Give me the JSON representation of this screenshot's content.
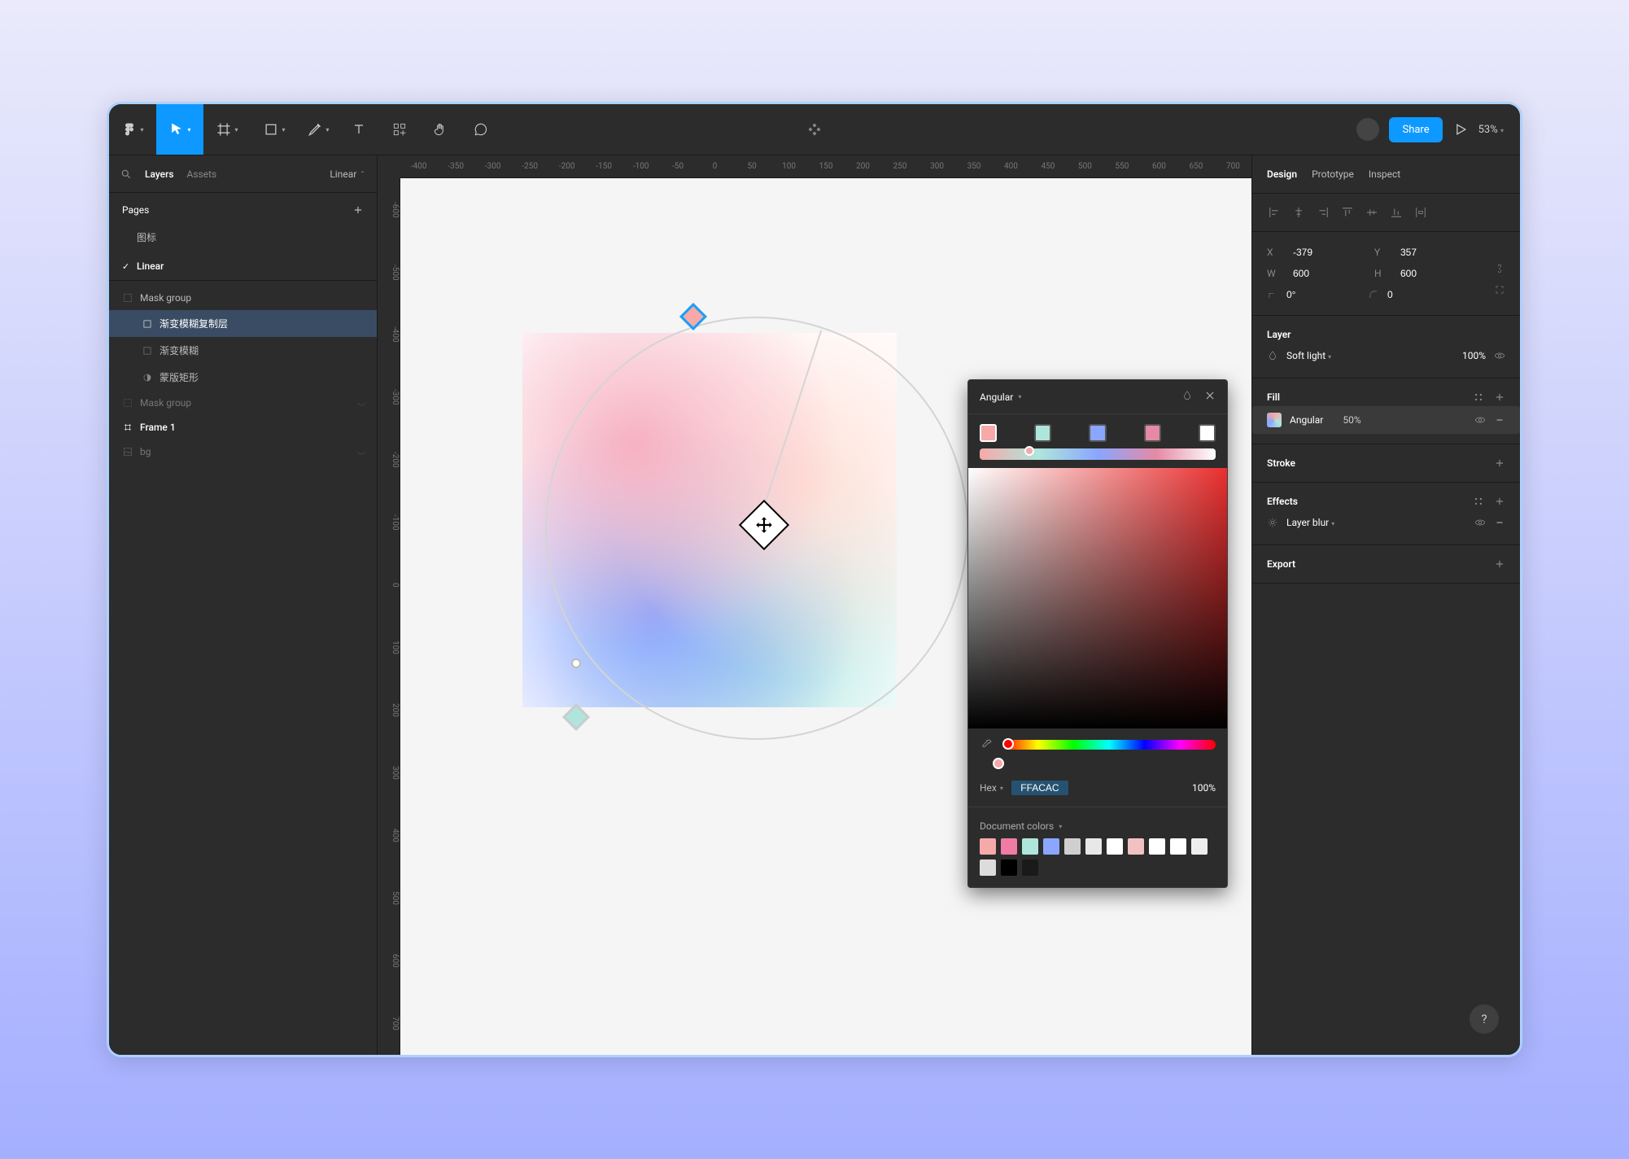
{
  "toolbar": {
    "share_label": "Share",
    "zoom_label": "53%"
  },
  "left_panel": {
    "tab_layers": "Layers",
    "tab_assets": "Assets",
    "file_name": "Linear",
    "pages_header": "Pages",
    "pages": [
      {
        "name": "图标",
        "selected": false
      },
      {
        "name": "Linear",
        "selected": true
      }
    ],
    "layers": {
      "mask_group_1": "Mask group",
      "blur_copy": "渐变模糊复制层",
      "blur": "渐变模糊",
      "mask_rect": "蒙版矩形",
      "mask_group_2": "Mask group",
      "frame1": "Frame 1",
      "bg": "bg"
    }
  },
  "rulers": {
    "h": [
      "-400",
      "-350",
      "-300",
      "-250",
      "-200",
      "-150",
      "-100",
      "-50",
      "0",
      "50",
      "100",
      "150",
      "200",
      "250",
      "300",
      "350",
      "400",
      "450",
      "500",
      "550",
      "600",
      "650",
      "700"
    ],
    "v": [
      "-600",
      "-500",
      "-400",
      "-300",
      "-200",
      "-100",
      "0",
      "100",
      "200",
      "300",
      "400",
      "500",
      "600",
      "700"
    ]
  },
  "right_panel": {
    "tab_design": "Design",
    "tab_prototype": "Prototype",
    "tab_inspect": "Inspect",
    "x": "-379",
    "y": "357",
    "w": "600",
    "h": "600",
    "rotation": "0°",
    "corner": "0",
    "layer_section": "Layer",
    "blend_mode": "Soft light",
    "layer_opacity": "100%",
    "fill_section": "Fill",
    "fill_type": "Angular",
    "fill_opacity": "50%",
    "stroke_section": "Stroke",
    "effects_section": "Effects",
    "effect_type": "Layer blur",
    "export_section": "Export"
  },
  "color_popup": {
    "title": "Angular",
    "stops": [
      "#f5a9a9",
      "#aee6dc",
      "#8aa6ff",
      "#e58aa4",
      "#ffffff"
    ],
    "active_stop_pct": 19,
    "hue_knob_pct": 0,
    "alpha_knob_pct": 100,
    "hex_mode": "Hex",
    "hex_value": "FFACAC",
    "opacity": "100%",
    "doc_colors_label": "Document colors",
    "doc_colors": [
      "#f5a9a9",
      "#f07ba3",
      "#aee6dc",
      "#8aa6ff",
      "#cfcfcf",
      "#e8e8e8",
      "#ffffff",
      "#f2c1c1",
      "#ffffff",
      "#ffffff",
      "#eeeeee",
      "#dcdcdc",
      "#000000",
      "#1a1a1a"
    ]
  }
}
